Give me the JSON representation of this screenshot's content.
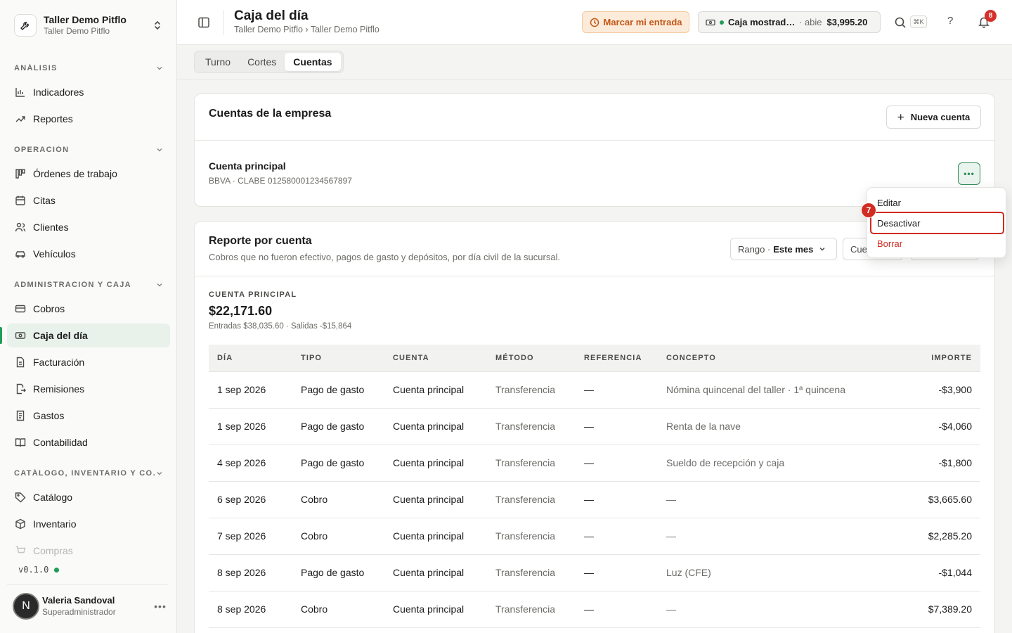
{
  "workspace": {
    "name": "Taller Demo Pitflo",
    "subtitle": "Taller Demo Pitflo"
  },
  "sidebar": {
    "sections": [
      {
        "label": "ANÁLISIS"
      },
      {
        "label": "OPERACIÓN"
      },
      {
        "label": "ADMINISTRACIÓN Y CAJA"
      },
      {
        "label": "CATÁLOGO, INVENTARIO Y CO…"
      }
    ],
    "items": [
      {
        "label": "Indicadores",
        "icon": "bar-chart-icon"
      },
      {
        "label": "Reportes",
        "icon": "trend-icon"
      },
      {
        "label": "Órdenes de trabajo",
        "icon": "kanban-icon"
      },
      {
        "label": "Citas",
        "icon": "calendar-icon"
      },
      {
        "label": "Clientes",
        "icon": "users-icon"
      },
      {
        "label": "Vehículos",
        "icon": "car-icon"
      },
      {
        "label": "Cobros",
        "icon": "card-icon"
      },
      {
        "label": "Caja del día",
        "icon": "cash-icon",
        "active": true
      },
      {
        "label": "Facturación",
        "icon": "document-icon"
      },
      {
        "label": "Remisiones",
        "icon": "file-export-icon"
      },
      {
        "label": "Gastos",
        "icon": "receipt-icon"
      },
      {
        "label": "Contabilidad",
        "icon": "book-icon"
      },
      {
        "label": "Catálogo",
        "icon": "tag-icon"
      },
      {
        "label": "Inventario",
        "icon": "box-icon"
      },
      {
        "label": "Compras",
        "icon": "cart-icon"
      }
    ],
    "version": "v0.1.0",
    "user": {
      "initial": "N",
      "name": "Valeria Sandoval",
      "role": "Superadministrador"
    }
  },
  "header": {
    "title": "Caja del día",
    "breadcrumb": "Taller Demo Pitflo › Taller Demo Pitflo",
    "clock_in_label": "Marcar mi entrada",
    "register": {
      "name": "Caja mostrad…",
      "state": "· abie",
      "amount": "$3,995.20"
    },
    "shortcut": "⌘K",
    "help": "?",
    "notifications": "8"
  },
  "tabs": [
    {
      "label": "Turno"
    },
    {
      "label": "Cortes"
    },
    {
      "label": "Cuentas",
      "active": true
    }
  ],
  "accounts_card": {
    "title": "Cuentas de la empresa",
    "new_button": "Nueva cuenta",
    "account": {
      "name": "Cuenta principal",
      "detail": "BBVA · CLABE 012580001234567897"
    }
  },
  "menu": {
    "step": "7",
    "items": [
      {
        "label": "Editar"
      },
      {
        "label": "Desactivar"
      },
      {
        "label": "Borrar"
      }
    ]
  },
  "report": {
    "title": "Reporte por cuenta",
    "subtitle": "Cobros que no fueron efectivo, pagos de gasto y depósitos, por día civil de la sucursal.",
    "range_label": "Rango ·",
    "range_value": "Este mes",
    "account_filter": "Cue",
    "summary": {
      "label": "CUENTA PRINCIPAL",
      "amount": "$22,171.60",
      "detail": "Entradas $38,035.60 · Salidas -$15,864"
    },
    "columns": [
      "DÍA",
      "TIPO",
      "CUENTA",
      "MÉTODO",
      "REFERENCIA",
      "CONCEPTO",
      "IMPORTE"
    ],
    "rows": [
      {
        "dia": "1 sep 2026",
        "tipo": "Pago de gasto",
        "cuenta": "Cuenta principal",
        "metodo": "Transferencia",
        "referencia": "—",
        "concepto": "Nómina quincenal del taller · 1ª quincena",
        "importe": "-$3,900"
      },
      {
        "dia": "1 sep 2026",
        "tipo": "Pago de gasto",
        "cuenta": "Cuenta principal",
        "metodo": "Transferencia",
        "referencia": "—",
        "concepto": "Renta de la nave",
        "importe": "-$4,060"
      },
      {
        "dia": "4 sep 2026",
        "tipo": "Pago de gasto",
        "cuenta": "Cuenta principal",
        "metodo": "Transferencia",
        "referencia": "—",
        "concepto": "Sueldo de recepción y caja",
        "importe": "-$1,800"
      },
      {
        "dia": "6 sep 2026",
        "tipo": "Cobro",
        "cuenta": "Cuenta principal",
        "metodo": "Transferencia",
        "referencia": "—",
        "concepto": "—",
        "importe": "$3,665.60"
      },
      {
        "dia": "7 sep 2026",
        "tipo": "Cobro",
        "cuenta": "Cuenta principal",
        "metodo": "Transferencia",
        "referencia": "—",
        "concepto": "—",
        "importe": "$2,285.20"
      },
      {
        "dia": "8 sep 2026",
        "tipo": "Pago de gasto",
        "cuenta": "Cuenta principal",
        "metodo": "Transferencia",
        "referencia": "—",
        "concepto": "Luz (CFE)",
        "importe": "-$1,044"
      },
      {
        "dia": "8 sep 2026",
        "tipo": "Cobro",
        "cuenta": "Cuenta principal",
        "metodo": "Transferencia",
        "referencia": "—",
        "concepto": "—",
        "importe": "$7,389.20"
      }
    ]
  },
  "colors": {
    "accent": "#1f9d55",
    "danger": "#d12b22",
    "warning_bg": "#fdebd9",
    "warning_text": "#c2581a"
  }
}
